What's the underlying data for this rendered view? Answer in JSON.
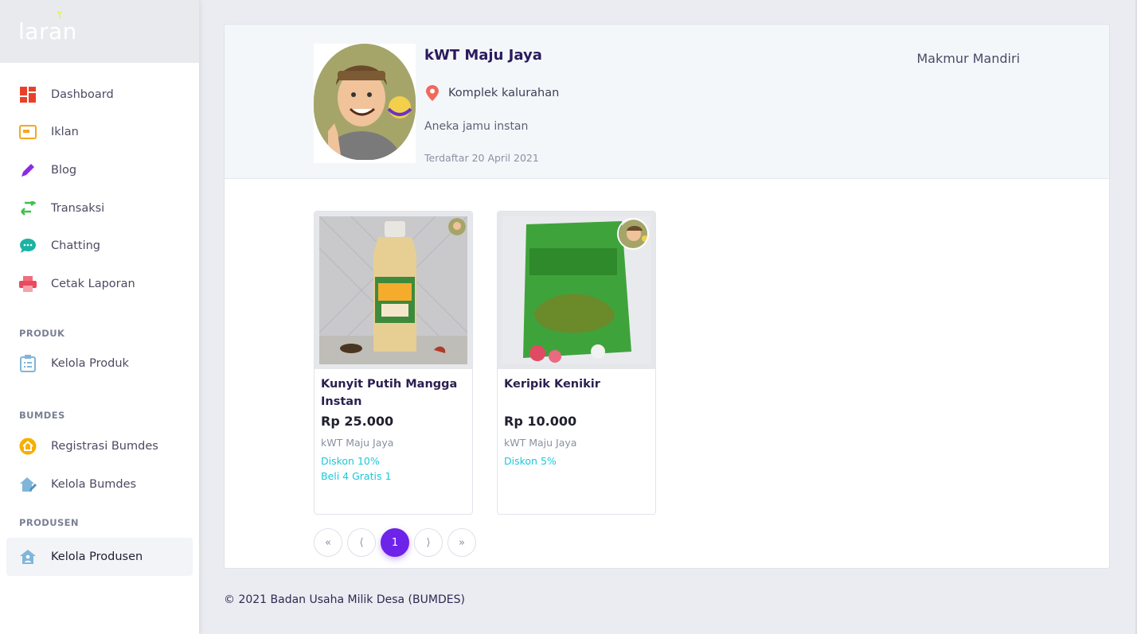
{
  "brand": {
    "logo_text": "laran"
  },
  "sidebar": {
    "items": [
      {
        "label": "Dashboard",
        "icon": "dashboard-icon"
      },
      {
        "label": "Iklan",
        "icon": "ads-icon"
      },
      {
        "label": "Blog",
        "icon": "pen-icon"
      },
      {
        "label": "Transaksi",
        "icon": "transfer-icon"
      },
      {
        "label": "Chatting",
        "icon": "chat-icon"
      },
      {
        "label": "Cetak Laporan",
        "icon": "printer-icon"
      }
    ],
    "sections": [
      {
        "heading": "PRODUK",
        "items": [
          {
            "label": "Kelola Produk",
            "icon": "clipboard-icon"
          }
        ]
      },
      {
        "heading": "BUMDES",
        "items": [
          {
            "label": "Registrasi Bumdes",
            "icon": "home-circle-icon"
          },
          {
            "label": "Kelola Bumdes",
            "icon": "house-edit-icon"
          }
        ]
      },
      {
        "heading": "PRODUSEN",
        "items": [
          {
            "label": "Kelola Produsen",
            "icon": "house-user-icon",
            "active": true
          }
        ]
      }
    ]
  },
  "profile": {
    "name": "kWT Maju Jaya",
    "location": "Komplek kalurahan",
    "description": "Aneka jamu instan",
    "registered": "Terdaftar 20 April 2021",
    "bumdes": "Makmur Mandiri"
  },
  "products": [
    {
      "title": "Kunyit Putih Mangga Instan",
      "price": "Rp 25.000",
      "seller": "kWT Maju Jaya",
      "promos": [
        "Diskon 10%",
        "Beli 4 Gratis 1"
      ]
    },
    {
      "title": "Keripik Kenikir",
      "price": "Rp 10.000",
      "seller": "kWT Maju Jaya",
      "promos": [
        "Diskon 5%"
      ]
    }
  ],
  "pagination": {
    "first": "«",
    "prev": "⟨",
    "current": "1",
    "next": "⟩",
    "last": "»"
  },
  "footer": {
    "text": "© 2021 Badan Usaha Milik Desa (BUMDES)"
  },
  "colors": {
    "accent": "#6d23e8",
    "promo": "#1cc8d8",
    "heading": "#2b1b5c"
  }
}
